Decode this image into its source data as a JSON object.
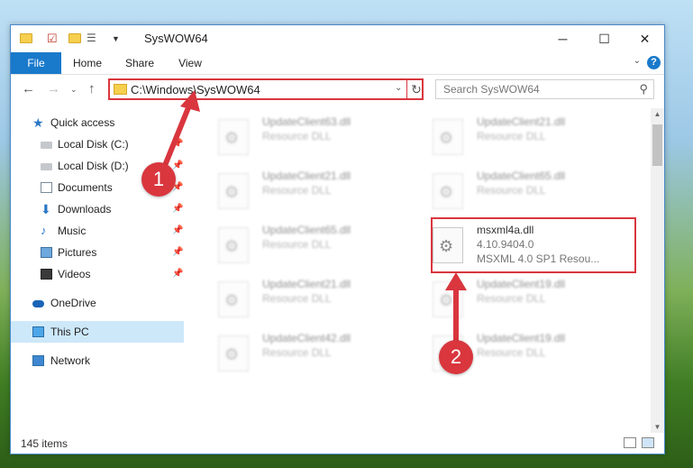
{
  "window": {
    "title": "SysWOW64",
    "minimize_glyph": "─",
    "maximize_glyph": "☐",
    "close_glyph": "✕"
  },
  "ribbon": {
    "file": "File",
    "home": "Home",
    "share": "Share",
    "view": "View",
    "help": "?"
  },
  "address": {
    "path": "C:\\Windows\\SysWOW64",
    "search_placeholder": "Search SysWOW64"
  },
  "navpane": {
    "items": [
      {
        "label": "Quick access",
        "icon": "star-icon",
        "pinned": false
      },
      {
        "label": "Local Disk (C:)",
        "icon": "drive-icon",
        "pinned": true
      },
      {
        "label": "Local Disk (D:)",
        "icon": "drive-icon",
        "pinned": true
      },
      {
        "label": "Documents",
        "icon": "document-icon",
        "pinned": true
      },
      {
        "label": "Downloads",
        "icon": "download-icon",
        "pinned": true
      },
      {
        "label": "Music",
        "icon": "music-icon",
        "pinned": true
      },
      {
        "label": "Pictures",
        "icon": "pictures-icon",
        "pinned": true
      },
      {
        "label": "Videos",
        "icon": "videos-icon",
        "pinned": true
      },
      {
        "label": "OneDrive",
        "icon": "onedrive-icon",
        "pinned": false
      },
      {
        "label": "This PC",
        "icon": "this-pc-icon",
        "pinned": false,
        "selected": true
      },
      {
        "label": "Network",
        "icon": "network-icon",
        "pinned": false
      }
    ]
  },
  "files": [
    {
      "name": "UpdateClient63.dll",
      "type": "Resource DLL"
    },
    {
      "name": "UpdateClient21.dll",
      "type": "Resource DLL"
    },
    {
      "name": "UpdateClient21.dll",
      "type": "Resource DLL"
    },
    {
      "name": "UpdateClient65.dll",
      "type": "Resource DLL"
    },
    {
      "name": "UpdateClient65.dll",
      "type": "Resource DLL"
    },
    {
      "name": "msxml4a.dll",
      "version": "4.10.9404.0",
      "type": "MSXML 4.0 SP1 Resou...",
      "highlighted": true
    },
    {
      "name": "UpdateClient21.dll",
      "type": "Resource DLL"
    },
    {
      "name": "UpdateClient19.dll",
      "type": "Resource DLL"
    },
    {
      "name": "UpdateClient42.dll",
      "type": "Resource DLL"
    },
    {
      "name": "UpdateClient19.dll",
      "type": "Resource DLL"
    }
  ],
  "status": {
    "item_count": "145 items"
  },
  "annotations": {
    "step1": "1",
    "step2": "2",
    "color": "#d9363e"
  }
}
